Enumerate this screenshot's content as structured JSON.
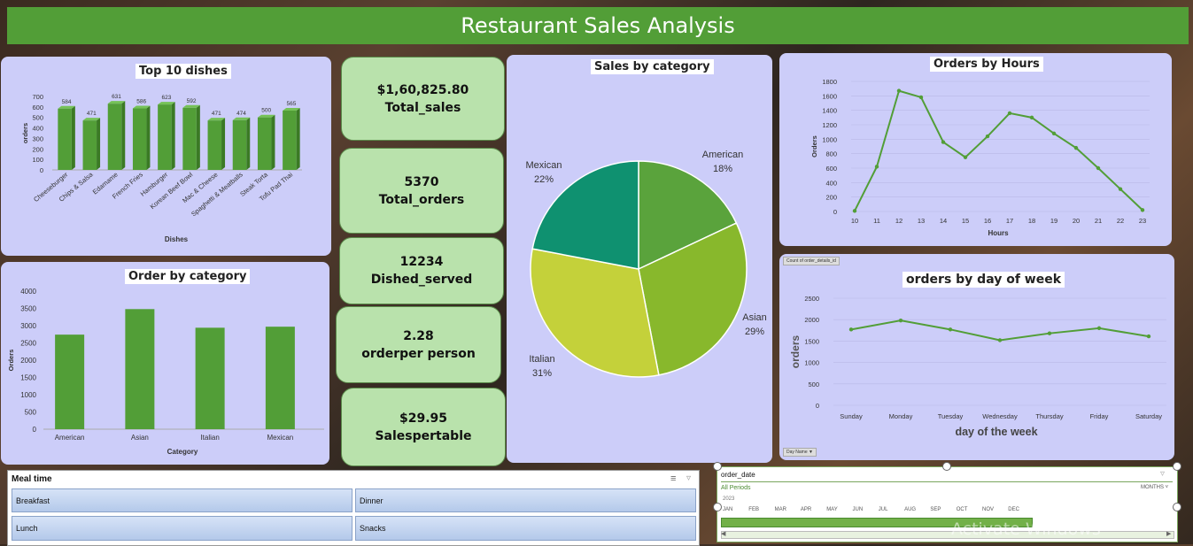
{
  "title": "Restaurant Sales  Analysis",
  "kpis": [
    {
      "value": "$1,60,825.80",
      "label": "Total_sales"
    },
    {
      "value": "5370",
      "label": "Total_orders"
    },
    {
      "value": "12234",
      "label": "Dished_served"
    },
    {
      "value": "2.28",
      "label": "orderper person"
    },
    {
      "value": "$29.95",
      "label": "Salespertable"
    }
  ],
  "top_dishes": {
    "title": "Top 10 dishes",
    "ylabel": "orders",
    "xlabel": "Dishes"
  },
  "order_by_category": {
    "title": "Order by category",
    "ylabel": "Orders",
    "xlabel": "Category"
  },
  "sales_by_category": {
    "title": "Sales by category"
  },
  "orders_by_hours": {
    "title": "Orders by Hours",
    "ylabel": "Orders",
    "xlabel": "Hours"
  },
  "orders_by_dow": {
    "title": "orders by day of week",
    "ylabel": "orders",
    "xlabel": "day  of the week",
    "field_button": "Count of order_details_id",
    "filter_button": "Day Name"
  },
  "meal_slicer": {
    "title": "Meal time",
    "items": [
      "Breakfast",
      "Dinner",
      "Lunch",
      "Snacks"
    ]
  },
  "timeline": {
    "title": "order_date",
    "all_periods": "All Periods",
    "level": "MONTHS",
    "year": "2023",
    "months": [
      "JAN",
      "FEB",
      "MAR",
      "APR",
      "MAY",
      "JUN",
      "JUL",
      "AUG",
      "SEP",
      "OCT",
      "NOV",
      "DEC"
    ]
  },
  "watermark": "Activate Windows",
  "colors": {
    "green": "#529e37",
    "panel": "#cccdf9",
    "kpi": "#b9e2ac"
  },
  "chart_data": [
    {
      "type": "bar",
      "title": "Top 10 dishes",
      "xlabel": "Dishes",
      "ylabel": "orders",
      "categories": [
        "Cheeseburger",
        "Chips & Salsa",
        "Edamame",
        "French Fries",
        "Hamburger",
        "Korean Beef Bowl",
        "Mac & Cheese",
        "Spaghetti & Meatballs",
        "Steak Torta",
        "Tofu Pad Thai"
      ],
      "values": [
        584,
        471,
        631,
        586,
        623,
        592,
        471,
        474,
        500,
        565
      ],
      "ylim": [
        0,
        700
      ],
      "yticks": [
        0,
        100,
        200,
        300,
        400,
        500,
        600,
        700
      ]
    },
    {
      "type": "bar",
      "title": "Order by category",
      "xlabel": "Category",
      "ylabel": "Orders",
      "categories": [
        "American",
        "Asian",
        "Italian",
        "Mexican"
      ],
      "values": [
        2740,
        3480,
        2940,
        2970
      ],
      "ylim": [
        0,
        4000
      ],
      "yticks": [
        0,
        500,
        1000,
        1500,
        2000,
        2500,
        3000,
        3500,
        4000
      ]
    },
    {
      "type": "pie",
      "title": "Sales by category",
      "categories": [
        "American",
        "Asian",
        "Italian",
        "Mexican"
      ],
      "values": [
        18,
        29,
        31,
        22
      ],
      "labels": [
        "18%",
        "29%",
        "31%",
        "22%"
      ],
      "colors": [
        "#5aa33c",
        "#88b82c",
        "#c4d13a",
        "#0f9170"
      ]
    },
    {
      "type": "line",
      "title": "Orders by Hours",
      "xlabel": "Hours",
      "ylabel": "Orders",
      "x": [
        10,
        11,
        12,
        13,
        14,
        15,
        16,
        17,
        18,
        19,
        20,
        21,
        22,
        23
      ],
      "values": [
        8,
        620,
        1670,
        1580,
        960,
        750,
        1040,
        1360,
        1300,
        1080,
        880,
        600,
        310,
        20
      ],
      "ylim": [
        0,
        1800
      ],
      "yticks": [
        0,
        200,
        400,
        600,
        800,
        1000,
        1200,
        1400,
        1600,
        1800
      ]
    },
    {
      "type": "line",
      "title": "orders by day of week",
      "xlabel": "day  of the week",
      "ylabel": "orders",
      "categories": [
        "Sunday",
        "Monday",
        "Tuesday",
        "Wednesday",
        "Thursday",
        "Friday",
        "Saturday"
      ],
      "values": [
        1770,
        1980,
        1770,
        1520,
        1680,
        1800,
        1610
      ],
      "ylim": [
        0,
        2500
      ],
      "yticks": [
        0,
        500,
        1000,
        1500,
        2000,
        2500
      ]
    }
  ]
}
